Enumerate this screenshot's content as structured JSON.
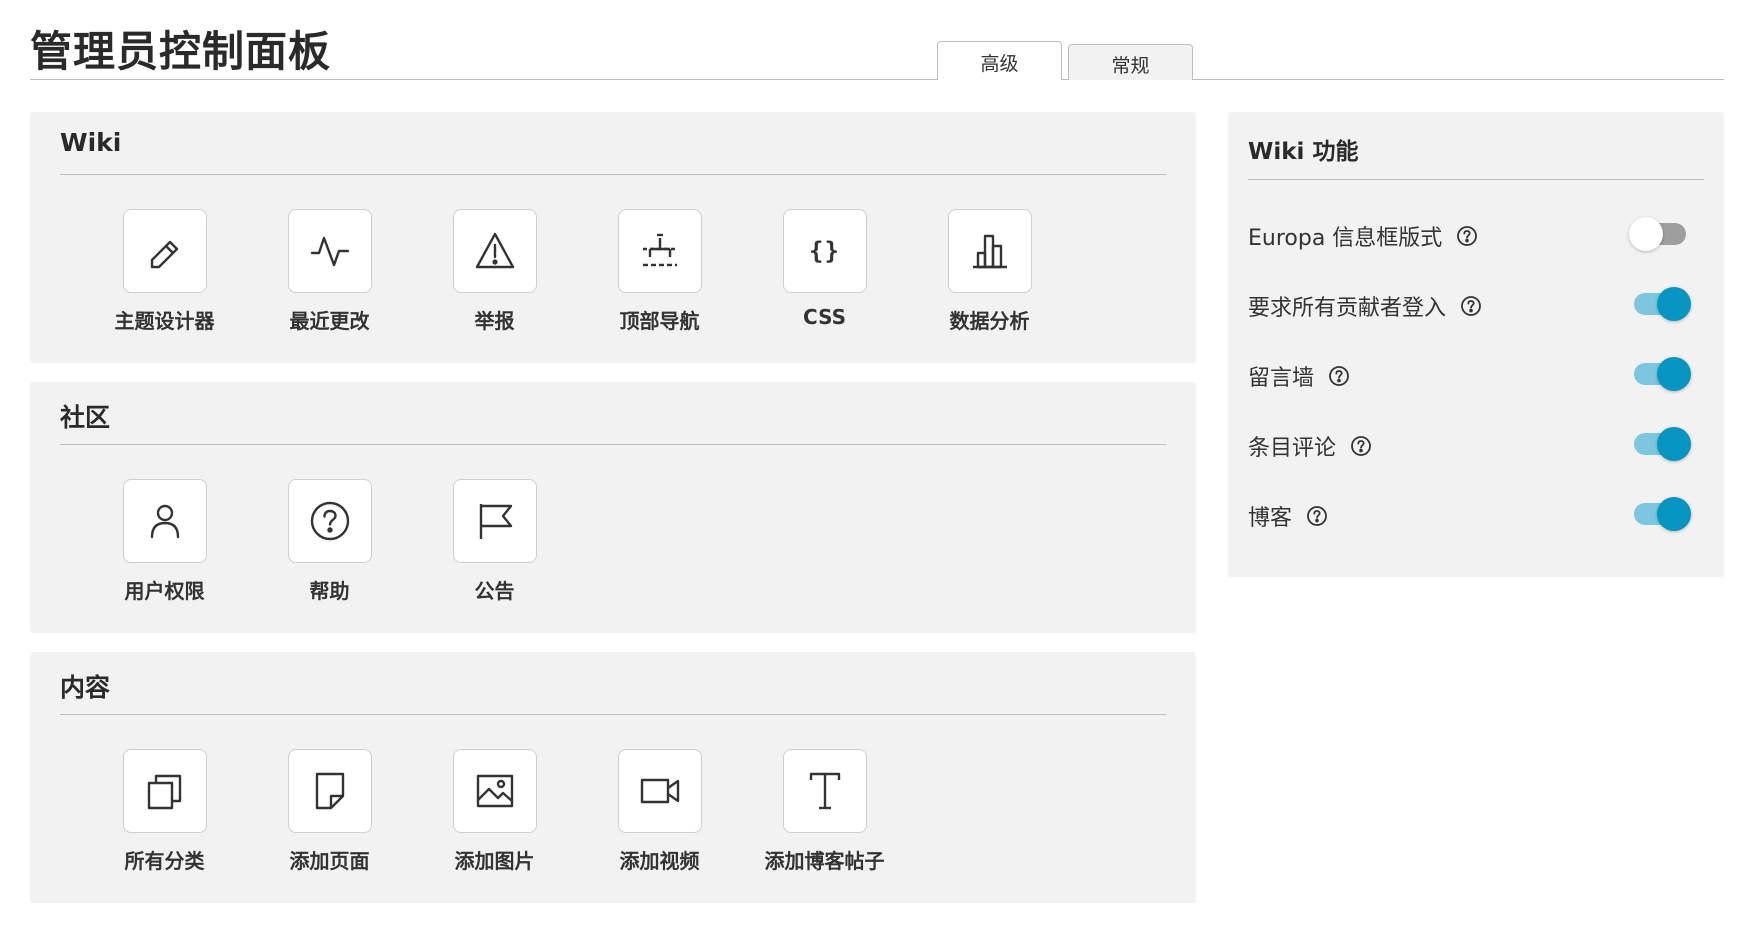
{
  "header": {
    "title": "管理员控制面板",
    "tabs": [
      {
        "label": "高级",
        "active": true
      },
      {
        "label": "常规",
        "active": false
      }
    ]
  },
  "sections": [
    {
      "title": "Wiki",
      "tiles": [
        {
          "label": "主题设计器",
          "icon": "pencil-icon"
        },
        {
          "label": "最近更改",
          "icon": "activity-icon"
        },
        {
          "label": "举报",
          "icon": "warning-icon"
        },
        {
          "label": "顶部导航",
          "icon": "top-navigation-icon"
        },
        {
          "label": "CSS",
          "icon": "css-braces-icon",
          "glyph": "{}"
        },
        {
          "label": "数据分析",
          "icon": "bar-chart-icon"
        }
      ]
    },
    {
      "title": "社区",
      "tiles": [
        {
          "label": "用户权限",
          "icon": "user-icon"
        },
        {
          "label": "帮助",
          "icon": "question-circle-icon"
        },
        {
          "label": "公告",
          "icon": "flag-icon"
        }
      ]
    },
    {
      "title": "内容",
      "tiles": [
        {
          "label": "所有分类",
          "icon": "categories-icon"
        },
        {
          "label": "添加页面",
          "icon": "page-icon"
        },
        {
          "label": "添加图片",
          "icon": "image-icon"
        },
        {
          "label": "添加视频",
          "icon": "video-icon"
        },
        {
          "label": "添加博客帖子",
          "icon": "text-icon"
        }
      ]
    }
  ],
  "features": {
    "title": "Wiki 功能",
    "items": [
      {
        "label": "Europa 信息框版式",
        "enabled": false
      },
      {
        "label": "要求所有贡献者登入",
        "enabled": true
      },
      {
        "label": "留言墙",
        "enabled": true
      },
      {
        "label": "条目评论",
        "enabled": true
      },
      {
        "label": "博客",
        "enabled": true
      }
    ]
  },
  "colors": {
    "toggle_on_knob": "#0694c1",
    "toggle_on_track": "#7cc7dd",
    "toggle_off_track": "#9e9e9e",
    "panel_bg": "#f2f2f2"
  }
}
